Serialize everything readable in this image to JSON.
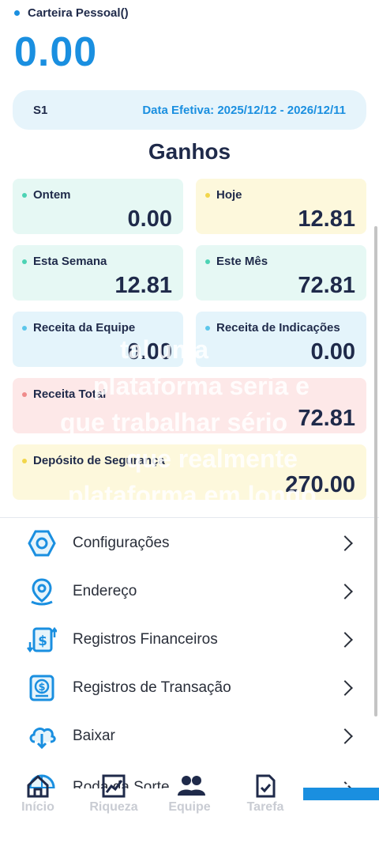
{
  "wallet": {
    "title": "Carteira Pessoal()",
    "balance": "0.00"
  },
  "period": {
    "level": "S1",
    "dates": "Data Efetiva: 2025/12/12 - 2026/12/11"
  },
  "earnings": {
    "title": "Ganhos",
    "cards": [
      {
        "label": "Ontem",
        "value": "0.00",
        "bg": "#e6f8f4",
        "dot": "#4cd3b4"
      },
      {
        "label": "Hoje",
        "value": "12.81",
        "bg": "#fdf8dc",
        "dot": "#f2d64b"
      },
      {
        "label": "Esta Semana",
        "value": "12.81",
        "bg": "#e6f8f4",
        "dot": "#4cd3b4"
      },
      {
        "label": "Este Mês",
        "value": "72.81",
        "bg": "#e6f8f4",
        "dot": "#4cd3b4"
      },
      {
        "label": "Receita da Equipe",
        "value": "0.00",
        "bg": "#e4f4fb",
        "dot": "#5cc6ea"
      },
      {
        "label": "Receita de Indicações",
        "value": "0.00",
        "bg": "#e4f4fb",
        "dot": "#5cc6ea"
      },
      {
        "label": "Receita Total",
        "value": "72.81",
        "bg": "#fde8e8",
        "dot": "#ef8a8a"
      },
      {
        "label": "Depósito de Segurança",
        "value": "270.00",
        "bg": "#fdf8dc",
        "dot": "#f2d64b"
      }
    ]
  },
  "overlay_text": [
    "tal uma",
    "plataforma seria e",
    "que trabalhar sério",
    "que realmente",
    "plataforma em longo"
  ],
  "menu": [
    {
      "label": "Configurações",
      "icon": "settings-hexagon-icon"
    },
    {
      "label": "Endereço",
      "icon": "location-pin-icon"
    },
    {
      "label": "Registros Financeiros",
      "icon": "financial-records-icon"
    },
    {
      "label": "Registros de Transação",
      "icon": "transaction-records-icon"
    },
    {
      "label": "Baixar",
      "icon": "cloud-download-icon"
    },
    {
      "label": "Roda da Sorte",
      "icon": "lucky-wheel-icon"
    }
  ],
  "tabs": [
    {
      "label": "Início",
      "icon": "home-icon"
    },
    {
      "label": "Riqueza",
      "icon": "chart-icon"
    },
    {
      "label": "Equipe",
      "icon": "team-icon"
    },
    {
      "label": "Tarefa",
      "icon": "task-icon"
    },
    {
      "label": "",
      "icon": "profile-icon"
    }
  ],
  "colors": {
    "accent": "#1a8fe0",
    "text": "#1f2a4a",
    "inactive": "#c9ccd3"
  }
}
